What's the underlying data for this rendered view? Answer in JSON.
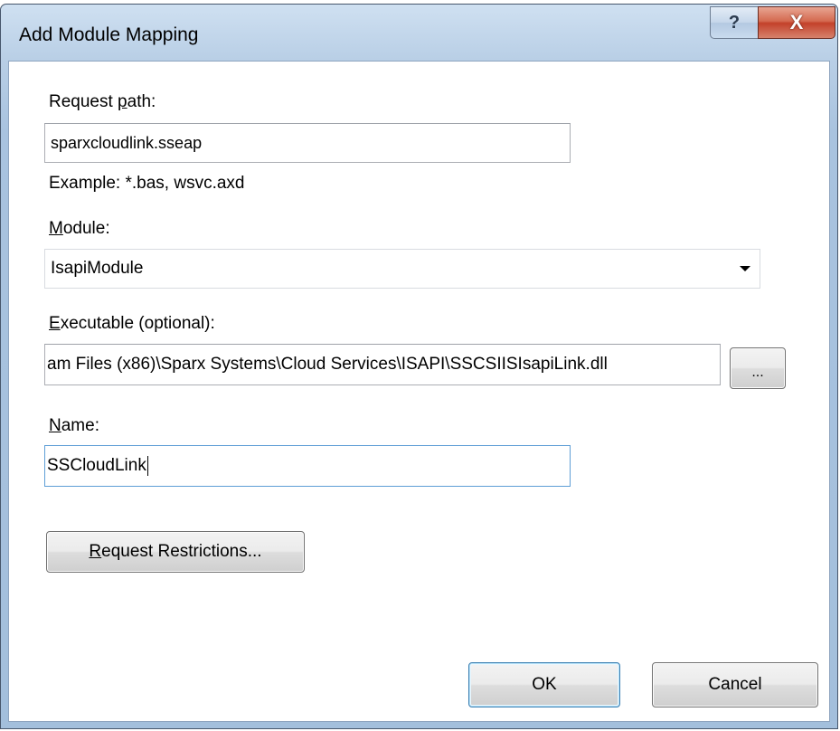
{
  "window": {
    "title": "Add Module Mapping",
    "help_glyph": "?",
    "close_glyph": "X"
  },
  "request_path": {
    "label_prefix": "Request ",
    "label_mnemonic": "p",
    "label_suffix": "ath:",
    "value": "sparxcloudlink.sseap",
    "example": "Example: *.bas, wsvc.axd"
  },
  "module": {
    "label_mnemonic": "M",
    "label_suffix": "odule:",
    "selected": "IsapiModule"
  },
  "executable": {
    "label_mnemonic": "E",
    "label_suffix": "xecutable (optional):",
    "value": "am Files (x86)\\Sparx Systems\\Cloud Services\\ISAPI\\SSCSIISIsapiLink.dll",
    "browse_label": "..."
  },
  "name": {
    "label_mnemonic": "N",
    "label_suffix": "ame:",
    "value": "SSCloudLink"
  },
  "buttons": {
    "restrictions_mnemonic": "R",
    "restrictions_suffix": "equest Restrictions...",
    "ok": "OK",
    "cancel": "Cancel"
  },
  "colors": {
    "frame": "#a9c3df",
    "close": "#c3412a"
  }
}
